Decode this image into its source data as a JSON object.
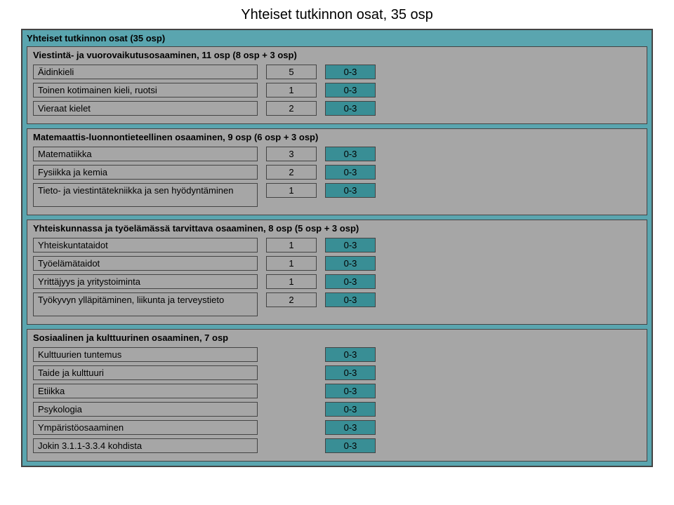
{
  "main_title": "Yhteiset tutkinnon osat, 35 osp",
  "outer_header": "Yhteiset tutkinnon osat (35 osp)",
  "sections": [
    {
      "header": "Viestintä- ja vuorovaikutusosaaminen, 11 osp (8 osp + 3 osp)",
      "rows": [
        {
          "name": "Äidinkieli",
          "credits": "5",
          "range": "0-3"
        },
        {
          "name": "Toinen kotimainen kieli, ruotsi",
          "credits": "1",
          "range": "0-3"
        },
        {
          "name": "Vieraat kielet",
          "credits": "2",
          "range": "0-3"
        }
      ]
    },
    {
      "header": "Matemaattis-luonnontieteellinen osaaminen, 9 osp (6 osp + 3 osp)",
      "rows": [
        {
          "name": "Matematiikka",
          "credits": "3",
          "range": "0-3"
        },
        {
          "name": "Fysiikka ja kemia",
          "credits": "2",
          "range": "0-3"
        },
        {
          "name": "Tieto- ja viestintätekniikka ja sen hyödyntäminen",
          "credits": "1",
          "range": "0-3",
          "tall": true
        }
      ]
    },
    {
      "header": "Yhteiskunnassa ja työelämässä tarvittava osaaminen, 8 osp (5 osp + 3 osp)",
      "rows": [
        {
          "name": "Yhteiskuntataidot",
          "credits": "1",
          "range": "0-3"
        },
        {
          "name": "Työelämätaidot",
          "credits": "1",
          "range": "0-3"
        },
        {
          "name": "Yrittäjyys ja yritystoiminta",
          "credits": "1",
          "range": "0-3"
        },
        {
          "name": "Työkyvyn ylläpitäminen, liikunta ja terveystieto",
          "credits": "2",
          "range": "0-3",
          "tall": true
        }
      ]
    },
    {
      "header": "Sosiaalinen ja kulttuurinen osaaminen, 7 osp",
      "rows": [
        {
          "name": "Kulttuurien tuntemus",
          "credits": "",
          "range": "0-3"
        },
        {
          "name": "Taide ja kulttuuri",
          "credits": "",
          "range": "0-3"
        },
        {
          "name": "Etiikka",
          "credits": "",
          "range": "0-3"
        },
        {
          "name": "Psykologia",
          "credits": "",
          "range": "0-3"
        },
        {
          "name": "Ympäristöosaaminen",
          "credits": "",
          "range": "0-3"
        },
        {
          "name": "Jokin 3.1.1-3.3.4 kohdista",
          "credits": "",
          "range": "0-3"
        }
      ]
    }
  ]
}
